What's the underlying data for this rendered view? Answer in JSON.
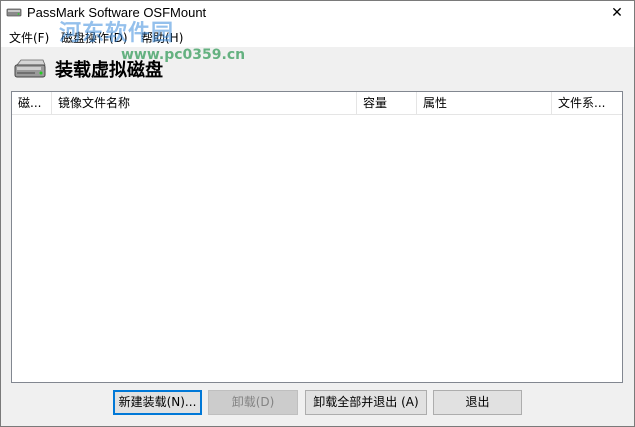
{
  "window": {
    "title": "PassMark Software OSFMount",
    "close_glyph": "✕"
  },
  "menu": {
    "items": [
      {
        "label": "文件(F)"
      },
      {
        "label": "磁盘操作(D)"
      },
      {
        "label": "帮助(H)"
      }
    ]
  },
  "watermark": {
    "text": "河东软件园",
    "url": "www.pc0359.cn"
  },
  "header": {
    "title": "装载虚拟磁盘"
  },
  "listview": {
    "columns": [
      {
        "label": "磁..."
      },
      {
        "label": "镜像文件名称"
      },
      {
        "label": "容量"
      },
      {
        "label": "属性"
      },
      {
        "label": "文件系..."
      }
    ],
    "rows": []
  },
  "buttons": {
    "new_mount": "新建装载(N)...",
    "unmount": "卸载(D)",
    "unmount_all_exit": "卸载全部并退出 (A)",
    "exit": "退出"
  }
}
